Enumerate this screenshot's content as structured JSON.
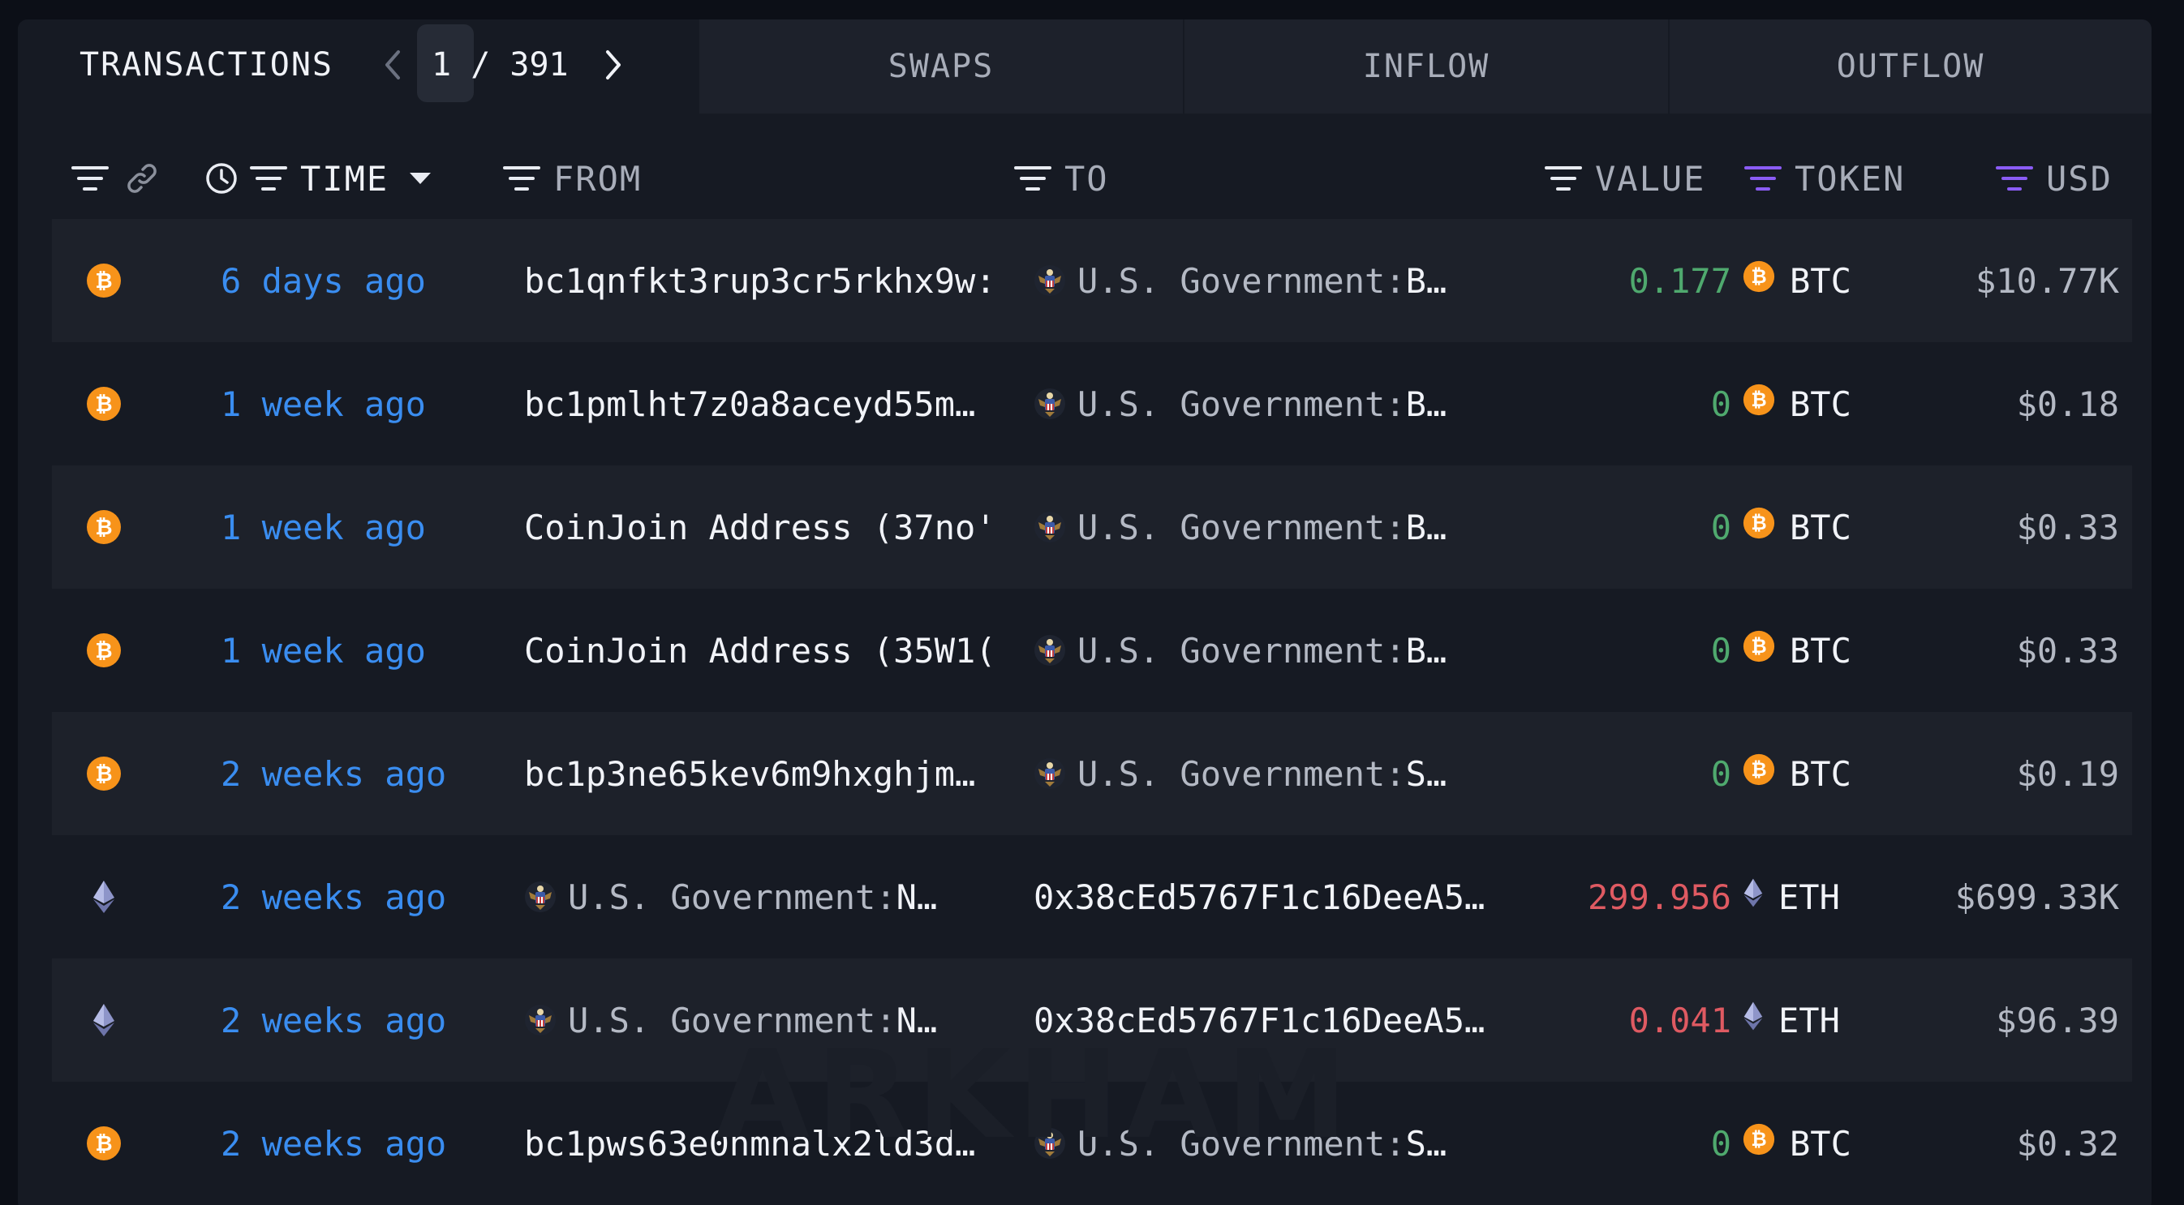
{
  "tabs": {
    "transactions_label": "TRANSACTIONS",
    "page_current": "1",
    "page_total": "391",
    "page_separator": "/",
    "swaps_label": "SWAPS",
    "inflow_label": "INFLOW",
    "outflow_label": "OUTFLOW"
  },
  "columns": {
    "time": "TIME",
    "from": "FROM",
    "to": "TO",
    "value": "VALUE",
    "token": "TOKEN",
    "usd": "USD"
  },
  "colors": {
    "accent_blue": "#3a8df0",
    "positive": "#4fa96e",
    "negative": "#df5a62",
    "btc": "#f7931a",
    "token_filter_purple": "#8b5cf6"
  },
  "rows": [
    {
      "chain": "btc",
      "time": "6 days ago",
      "from": "bc1qnfkt3rup3cr5rkhx9w:",
      "from_entity": false,
      "to_name": "U.S. Government:",
      "to_rest": " B…",
      "to_entity": true,
      "value": "0.177",
      "value_sign": "pos",
      "token": "BTC",
      "usd": "$10.77K"
    },
    {
      "chain": "btc",
      "time": "1 week ago",
      "from": "bc1pmlht7z0a8aceyd55m…",
      "from_entity": false,
      "to_name": "U.S. Government:",
      "to_rest": " B…",
      "to_entity": true,
      "value": "0",
      "value_sign": "pos",
      "token": "BTC",
      "usd": "$0.18"
    },
    {
      "chain": "btc",
      "time": "1 week ago",
      "from": "CoinJoin Address (37no'",
      "from_entity": false,
      "to_name": "U.S. Government:",
      "to_rest": " B…",
      "to_entity": true,
      "value": "0",
      "value_sign": "pos",
      "token": "BTC",
      "usd": "$0.33"
    },
    {
      "chain": "btc",
      "time": "1 week ago",
      "from": "CoinJoin Address (35W1(",
      "from_entity": false,
      "to_name": "U.S. Government:",
      "to_rest": " B…",
      "to_entity": true,
      "value": "0",
      "value_sign": "pos",
      "token": "BTC",
      "usd": "$0.33"
    },
    {
      "chain": "btc",
      "time": "2 weeks ago",
      "from": "bc1p3ne65kev6m9hxghjm…",
      "from_entity": false,
      "to_name": "U.S. Government:",
      "to_rest": " S…",
      "to_entity": true,
      "value": "0",
      "value_sign": "pos",
      "token": "BTC",
      "usd": "$0.19"
    },
    {
      "chain": "eth",
      "time": "2 weeks ago",
      "from_name": "U.S. Government:",
      "from_rest": " N…",
      "from_entity": true,
      "to": "0x38cEd5767F1c16DeeA5…",
      "to_entity": false,
      "value": "299.956",
      "value_sign": "neg",
      "token": "ETH",
      "usd": "$699.33K"
    },
    {
      "chain": "eth",
      "time": "2 weeks ago",
      "from_name": "U.S. Government:",
      "from_rest": " N…",
      "from_entity": true,
      "to": "0x38cEd5767F1c16DeeA5…",
      "to_entity": false,
      "value": "0.041",
      "value_sign": "neg",
      "token": "ETH",
      "usd": "$96.39"
    },
    {
      "chain": "btc",
      "time": "2 weeks ago",
      "from": "bc1pws63e0hmnalx2ld3d…",
      "from_entity": false,
      "to_name": "U.S. Government:",
      "to_rest": " S…",
      "to_entity": true,
      "value": "0",
      "value_sign": "pos",
      "token": "BTC",
      "usd": "$0.32"
    }
  ],
  "watermark": "ARKHAM"
}
